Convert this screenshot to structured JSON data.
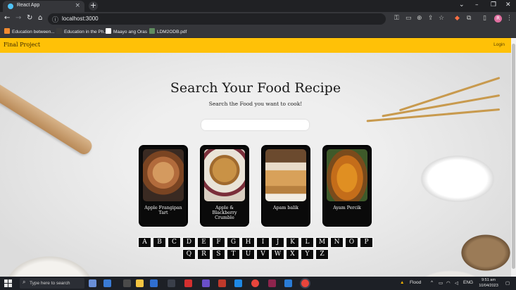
{
  "browser": {
    "tab_title": "React App",
    "url": "localhost:3000",
    "bookmarks": [
      {
        "label": "Education between...",
        "color": "#f28b30"
      },
      {
        "label": "Education in the Ph...",
        "color": "#3b3b3b"
      },
      {
        "label": "Maayo ang Oras",
        "color": "#ffffff"
      },
      {
        "label": "LDM2ODB.pdf",
        "color": "#5f8d5f"
      }
    ]
  },
  "navbar": {
    "brand": "Final Project",
    "login": "Login"
  },
  "hero": {
    "title": "Search Your Food Recipe",
    "subtitle": "Search the Food you want to cook!",
    "search_value": "",
    "search_placeholder": ""
  },
  "recipes": [
    {
      "name": "Apple Frangipan Tart",
      "image": "apple-tart",
      "color_a": "#b26b3c",
      "color_b": "#6b3a1f"
    },
    {
      "name": "Apple & Blackberry Crumble",
      "image": "crumble",
      "color_a": "#c99246",
      "color_b": "#7a2e3a"
    },
    {
      "name": "Apam balik",
      "image": "apam-balik",
      "color_a": "#d8a15a",
      "color_b": "#e9dcc9"
    },
    {
      "name": "Ayam Percik",
      "image": "ayam-percik",
      "color_a": "#e08f22",
      "color_b": "#a4561a"
    }
  ],
  "letters_row1": [
    "A",
    "B",
    "C",
    "D",
    "E",
    "F",
    "G",
    "H",
    "I",
    "J",
    "K",
    "L",
    "M",
    "N",
    "O",
    "P"
  ],
  "letters_row2": [
    "Q",
    "R",
    "S",
    "T",
    "U",
    "V",
    "W",
    "X",
    "Y",
    "Z"
  ],
  "taskbar": {
    "search_text": "Type here to search",
    "weather": "Flood",
    "lang": "ENG",
    "time": "9:51 am",
    "date": "10/04/2023"
  }
}
